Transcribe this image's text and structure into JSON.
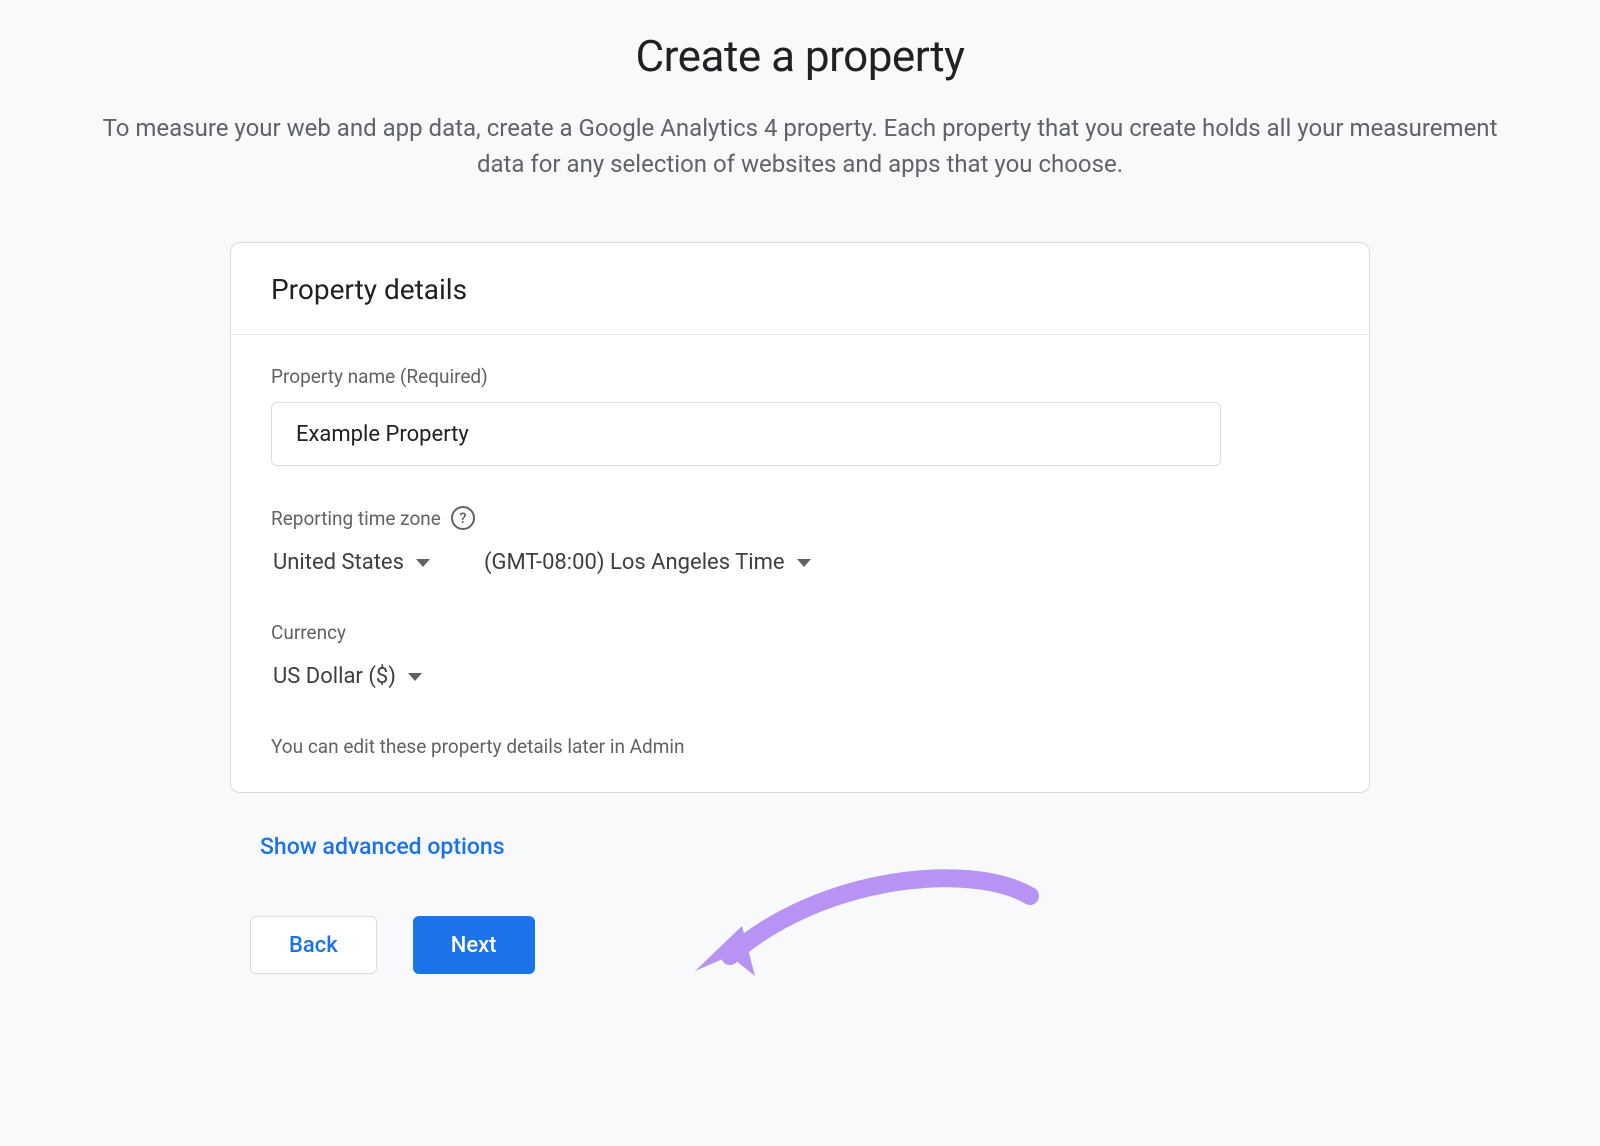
{
  "page": {
    "title": "Create a property",
    "description": "To measure your web and app data, create a Google Analytics 4 property. Each property that you create holds all your measurement data for any selection of websites and apps that you choose."
  },
  "card": {
    "header": "Property details",
    "property_name": {
      "label": "Property name (Required)",
      "value": "Example Property"
    },
    "time_zone": {
      "label": "Reporting time zone",
      "country": "United States",
      "zone": "(GMT-08:00) Los Angeles Time"
    },
    "currency": {
      "label": "Currency",
      "value": "US Dollar ($)"
    },
    "hint": "You can edit these property details later in Admin"
  },
  "advanced_link": "Show advanced options",
  "buttons": {
    "back": "Back",
    "next": "Next"
  },
  "icons": {
    "help": "?"
  }
}
